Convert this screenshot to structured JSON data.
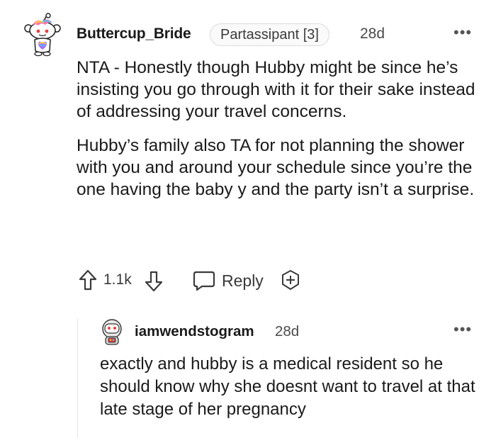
{
  "comment": {
    "author": "Buttercup_Bride",
    "flair": "Partassipant [3]",
    "time": "28d",
    "more_label": "•••",
    "paragraphs": [
      "NTA - Honestly though Hubby might be since he’s insisting you go through with it for their sake instead of addressing your travel concerns.",
      "Hubby’s family also TA for not planning the shower with you and around your schedule since you’re the one having the baby y and the party isn’t a surprise."
    ],
    "votes": "1.1k",
    "reply_label": "Reply",
    "icons": {
      "avatar": "snoo-avatar-icon",
      "upvote": "upvote-arrow-icon",
      "downvote": "downvote-arrow-icon",
      "reply": "speech-bubble-icon",
      "award": "award-plus-icon"
    }
  },
  "reply": {
    "author": "iamwendstogram",
    "time": "28d",
    "more_label": "•••",
    "text": "exactly and hubby is a medical resident so he should know why she doesnt want to travel at that late stage of her pregnancy",
    "icons": {
      "avatar": "snoo-astronaut-avatar-icon"
    }
  },
  "colors": {
    "text": "#1a1a1b",
    "muted": "#4a4a4a",
    "thread_line": "#e6e6e6"
  }
}
